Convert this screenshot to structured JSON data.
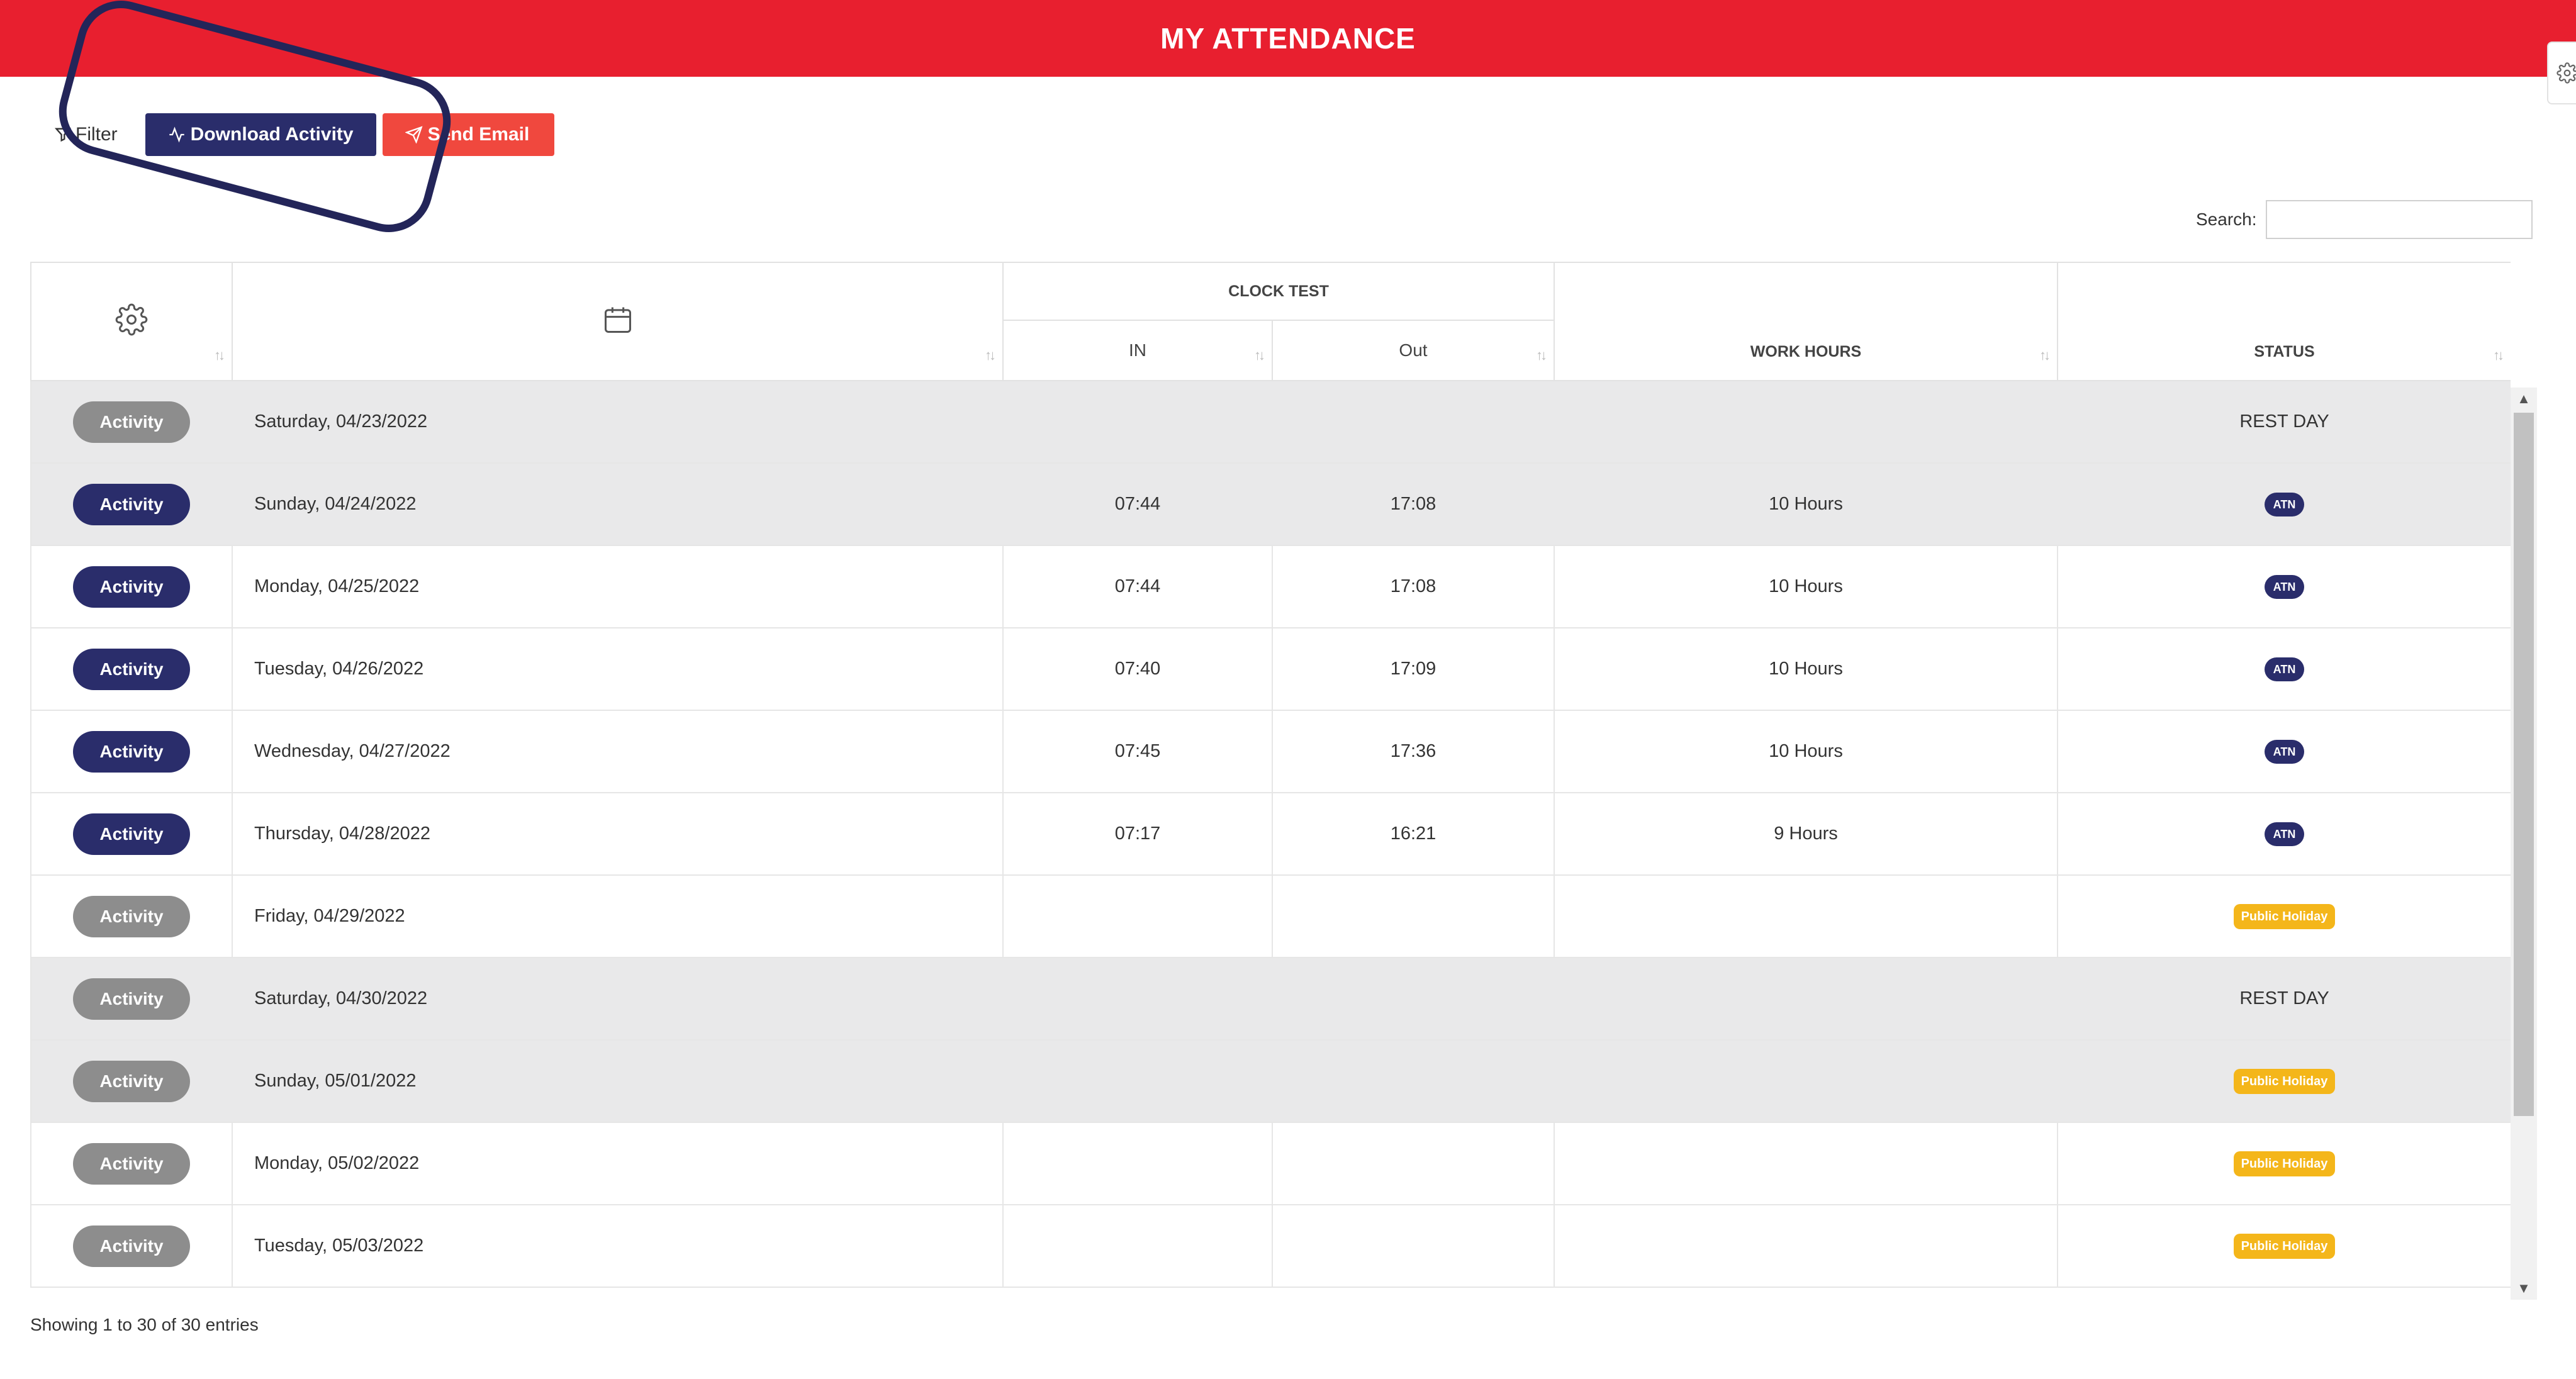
{
  "header": {
    "title": "MY ATTENDANCE"
  },
  "toolbar": {
    "filter_label": "Filter",
    "download_label": "Download Activity",
    "email_label": "Send Email"
  },
  "search": {
    "label": "Search:",
    "value": "",
    "placeholder": ""
  },
  "table": {
    "group_header": "CLOCK TEST",
    "columns": {
      "in": "IN",
      "out": "Out",
      "work_hours": "WORK HOURS",
      "status": "STATUS"
    },
    "rows": [
      {
        "activity": "Activity",
        "date": "Saturday, 04/23/2022",
        "in": "",
        "out": "",
        "hours": "",
        "status": "REST DAY"
      },
      {
        "activity": "Activity",
        "date": "Sunday, 04/24/2022",
        "in": "07:44",
        "out": "17:08",
        "hours": "10 Hours",
        "status": "ATN"
      },
      {
        "activity": "Activity",
        "date": "Monday, 04/25/2022",
        "in": "07:44",
        "out": "17:08",
        "hours": "10 Hours",
        "status": "ATN"
      },
      {
        "activity": "Activity",
        "date": "Tuesday, 04/26/2022",
        "in": "07:40",
        "out": "17:09",
        "hours": "10 Hours",
        "status": "ATN"
      },
      {
        "activity": "Activity",
        "date": "Wednesday, 04/27/2022",
        "in": "07:45",
        "out": "17:36",
        "hours": "10 Hours",
        "status": "ATN"
      },
      {
        "activity": "Activity",
        "date": "Thursday, 04/28/2022",
        "in": "07:17",
        "out": "16:21",
        "hours": "9 Hours",
        "status": "ATN"
      },
      {
        "activity": "Activity",
        "date": "Friday, 04/29/2022",
        "in": "",
        "out": "",
        "hours": "",
        "status": "Public Holiday"
      },
      {
        "activity": "Activity",
        "date": "Saturday, 04/30/2022",
        "in": "",
        "out": "",
        "hours": "",
        "status": "REST DAY"
      },
      {
        "activity": "Activity",
        "date": "Sunday, 05/01/2022",
        "in": "",
        "out": "",
        "hours": "",
        "status": "Public Holiday"
      },
      {
        "activity": "Activity",
        "date": "Monday, 05/02/2022",
        "in": "",
        "out": "",
        "hours": "",
        "status": "Public Holiday"
      },
      {
        "activity": "Activity",
        "date": "Tuesday, 05/03/2022",
        "in": "",
        "out": "",
        "hours": "",
        "status": "Public Holiday"
      }
    ]
  },
  "footer": {
    "info": "Showing 1 to 30 of 30 entries"
  },
  "colors": {
    "header_red": "#e81f2f",
    "navy": "#2a2d6b",
    "email_red": "#f0483e",
    "holiday_yellow": "#f4b61a",
    "grey_pill": "#8d8d8d"
  }
}
